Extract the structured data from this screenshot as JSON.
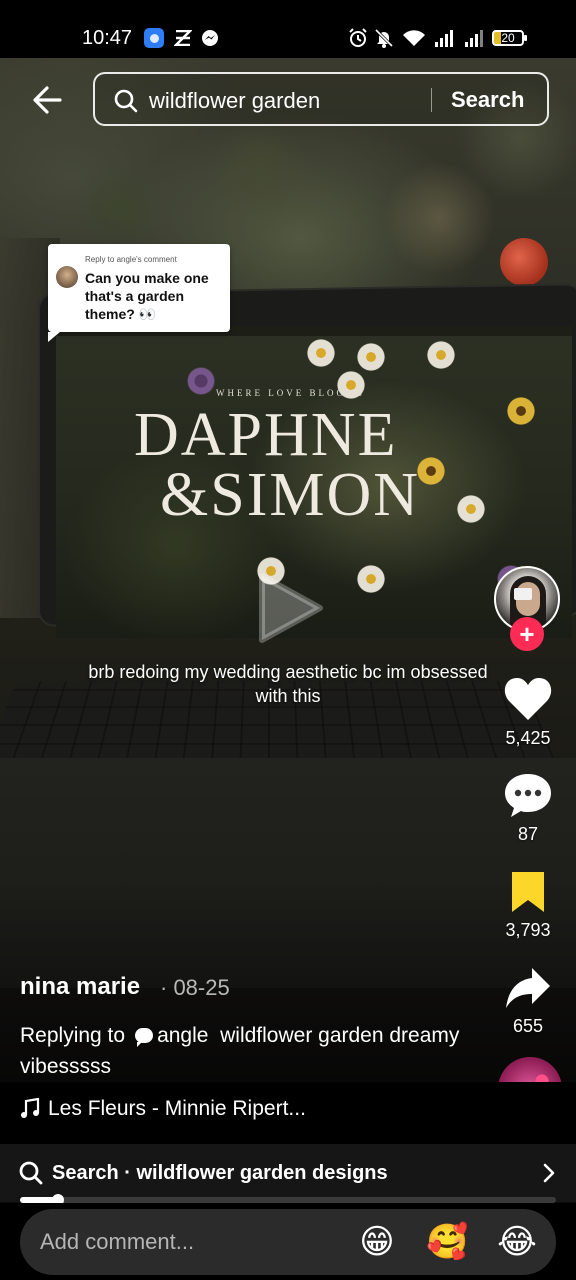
{
  "status_bar": {
    "time": "10:47",
    "battery": "20",
    "icons": [
      "app-icon",
      "x-app-icon",
      "messenger-icon",
      "alarm-icon",
      "mute-icon",
      "wifi-icon",
      "signal-icon",
      "signal-icon"
    ]
  },
  "search": {
    "query": "wildflower garden",
    "button": "Search"
  },
  "reply_sticker": {
    "meta": "Reply to angle's comment",
    "text": "Can you make one that's a garden theme? 👀"
  },
  "video_text": {
    "screen_tagline": "WHERE LOVE BLOOMS",
    "screen_title_line1": "DAPHNE",
    "screen_title_line2": "&SIMON",
    "caption": "brb redoing my wedding aesthetic bc im obsessed with this"
  },
  "actions": {
    "likes": "5,425",
    "comments": "87",
    "saves": "3,793",
    "shares": "655"
  },
  "post": {
    "author": "nina marie",
    "date": "· 08-25",
    "replying_prefix": "Replying to",
    "reply_user": "angle",
    "description": "wildflower garden dreamy vibesssss"
  },
  "music": {
    "title": "Les Fleurs - Minnie Ripert..."
  },
  "search_suggestion": {
    "text": "Search · wildflower garden designs"
  },
  "playback": {
    "progress_fraction": 0.07
  },
  "comment": {
    "placeholder": "Add comment...",
    "emojis": [
      "😁",
      "🥰",
      "😂"
    ]
  },
  "colors": {
    "accent_follow": "#fe2c55",
    "save_active": "#fcd72a"
  }
}
